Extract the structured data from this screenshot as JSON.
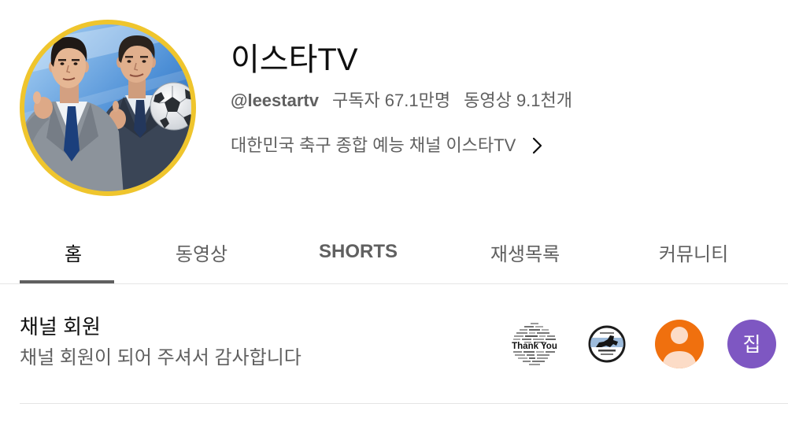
{
  "channel": {
    "name": "이스타TV",
    "handle": "@leestartv",
    "subscribers": "구독자 67.1만명",
    "videos": "동영상 9.1천개",
    "description": "대한민국 축구 종합 예능 채널 이스타TV",
    "avatar_ring_color": "#efc52d",
    "more_icon": "chevron-right-icon"
  },
  "tabs": [
    {
      "label": "홈",
      "active": true
    },
    {
      "label": "동영상",
      "active": false
    },
    {
      "label": "SHORTS",
      "active": false
    },
    {
      "label": "재생목록",
      "active": false
    },
    {
      "label": "커뮤니티",
      "active": false
    }
  ],
  "membership": {
    "title": "채널 회원",
    "subtitle": "채널 회원이 되어 주셔서 감사합니다",
    "members": [
      {
        "avatar_icon": "thank-you-word-cloud",
        "text": "Thank You"
      },
      {
        "avatar_icon": "horse-emblem-logo"
      },
      {
        "avatar_icon": "default-person-icon",
        "color": "#f0700e"
      },
      {
        "avatar_icon": "letter-avatar",
        "text": "집",
        "color": "#7e57c2"
      }
    ]
  },
  "colors": {
    "text_primary": "#0f0f0f",
    "text_secondary": "#606060",
    "divider": "#e5e5e5"
  }
}
